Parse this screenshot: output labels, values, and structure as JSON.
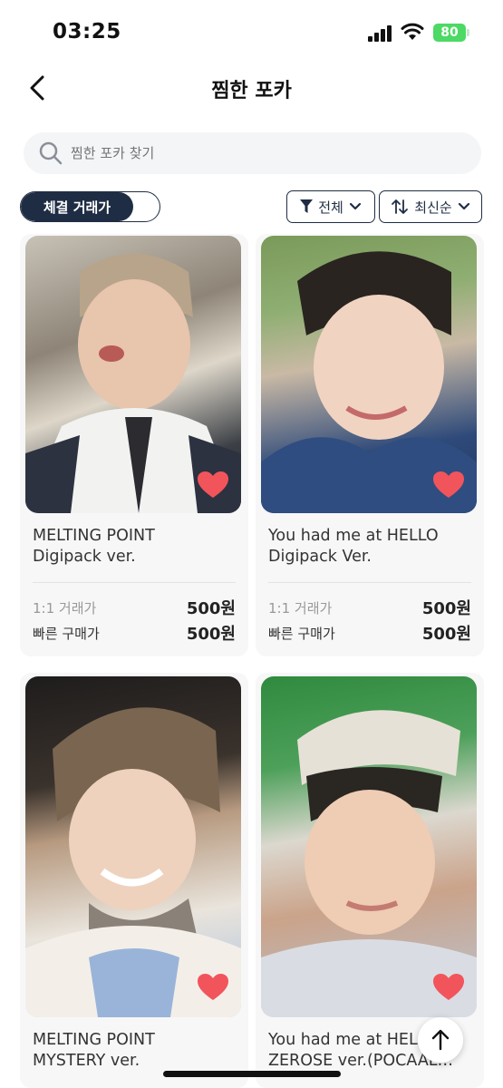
{
  "status_bar": {
    "time": "03:25",
    "battery": "80"
  },
  "header": {
    "title": "찜한 포카"
  },
  "search": {
    "placeholder": "찜한 포카 찾기"
  },
  "filters": {
    "toggle_label": "체결 거래가",
    "category_label": "전체",
    "sort_label": "최신순"
  },
  "cards": [
    {
      "title_line1": "MELTING POINT",
      "title_line2": "Digipack ver.",
      "price1_label": "1:1 거래가",
      "price1_value": "500원",
      "price2_label": "빠른 구매가",
      "price2_value": "500원",
      "liked": true
    },
    {
      "title_line1": "You had me at HELLO",
      "title_line2": "Digipack Ver.",
      "price1_label": "1:1 거래가",
      "price1_value": "500원",
      "price2_label": "빠른 구매가",
      "price2_value": "500원",
      "liked": true
    },
    {
      "title_line1": "MELTING POINT",
      "title_line2": "MYSTERY ver.",
      "liked": true
    },
    {
      "title_line1": "You had me at HELLO",
      "title_line2": "ZEROSE ver.(POCAAL…",
      "liked": true
    }
  ],
  "colors": {
    "navy": "#1f2d44",
    "heart": "#f2545b",
    "battery": "#4cd964"
  },
  "icons": [
    "back-arrow-icon",
    "search-icon",
    "filter-funnel-icon",
    "chevron-down-icon",
    "sort-arrows-icon",
    "heart-icon",
    "arrow-up-icon"
  ]
}
